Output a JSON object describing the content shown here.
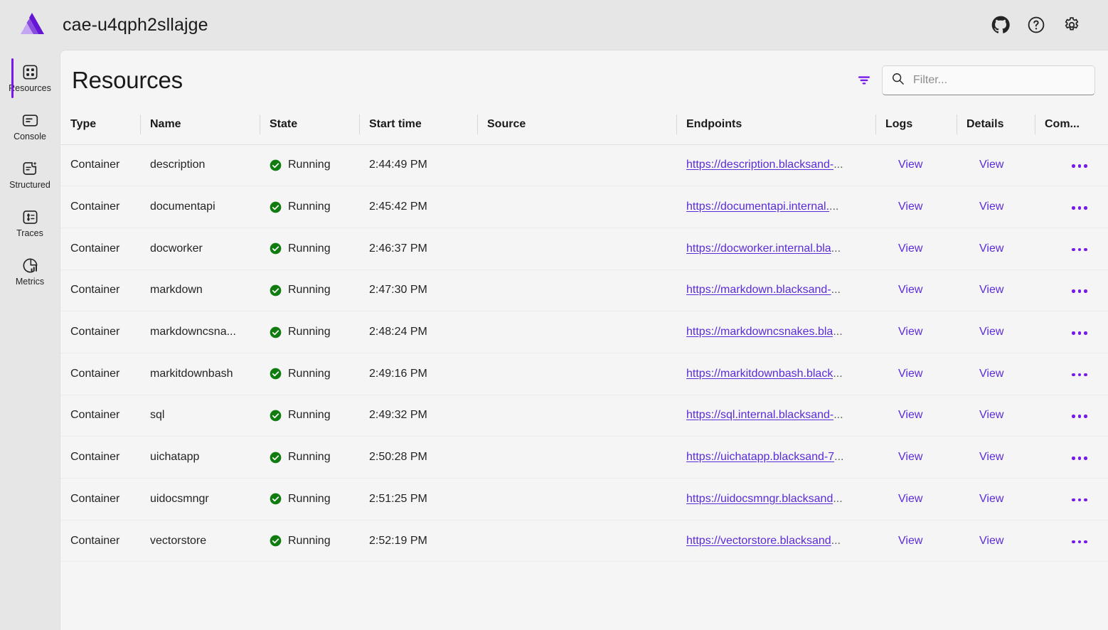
{
  "header": {
    "app_title": "cae-u4qph2sllajge",
    "logo_icon": "aspire-logo-icon",
    "actions": [
      {
        "name": "github-icon",
        "label": "GitHub"
      },
      {
        "name": "help-icon",
        "label": "Help"
      },
      {
        "name": "gear-icon",
        "label": "Settings"
      }
    ]
  },
  "sidebar": {
    "items": [
      {
        "label": "Resources",
        "icon": "grid-apps-icon",
        "active": true
      },
      {
        "label": "Console",
        "icon": "console-lines-icon",
        "active": false
      },
      {
        "label": "Structured",
        "icon": "structured-logs-icon",
        "active": false
      },
      {
        "label": "Traces",
        "icon": "traces-icon",
        "active": false
      },
      {
        "label": "Metrics",
        "icon": "metrics-pie-icon",
        "active": false
      }
    ]
  },
  "page": {
    "title": "Resources",
    "filter_toggle_icon": "filter-icon",
    "search": {
      "icon": "search-icon",
      "placeholder": "Filter...",
      "value": ""
    }
  },
  "table": {
    "columns": [
      "Type",
      "Name",
      "State",
      "Start time",
      "Source",
      "Endpoints",
      "Logs",
      "Details",
      "Com..."
    ],
    "rows": [
      {
        "type": "Container",
        "name": "description",
        "state": "Running",
        "state_icon": "success-check-icon",
        "start_time": "2:44:49 PM",
        "source": "",
        "endpoint": "https://description.blacksand-",
        "endpoint_truncated": "...",
        "logs": "View",
        "details": "View",
        "commands_icon": "more-actions-icon"
      },
      {
        "type": "Container",
        "name": "documentapi",
        "state": "Running",
        "state_icon": "success-check-icon",
        "start_time": "2:45:42 PM",
        "source": "",
        "endpoint": "https://documentapi.internal.",
        "endpoint_truncated": "...",
        "logs": "View",
        "details": "View",
        "commands_icon": "more-actions-icon"
      },
      {
        "type": "Container",
        "name": "docworker",
        "state": "Running",
        "state_icon": "success-check-icon",
        "start_time": "2:46:37 PM",
        "source": "",
        "endpoint": "https://docworker.internal.bla",
        "endpoint_truncated": "...",
        "logs": "View",
        "details": "View",
        "commands_icon": "more-actions-icon"
      },
      {
        "type": "Container",
        "name": "markdown",
        "state": "Running",
        "state_icon": "success-check-icon",
        "start_time": "2:47:30 PM",
        "source": "",
        "endpoint": "https://markdown.blacksand-",
        "endpoint_truncated": "...",
        "logs": "View",
        "details": "View",
        "commands_icon": "more-actions-icon"
      },
      {
        "type": "Container",
        "name": "markdowncsna...",
        "state": "Running",
        "state_icon": "success-check-icon",
        "start_time": "2:48:24 PM",
        "source": "",
        "endpoint": "https://markdowncsnakes.bla",
        "endpoint_truncated": "...",
        "logs": "View",
        "details": "View",
        "commands_icon": "more-actions-icon"
      },
      {
        "type": "Container",
        "name": "markitdownbash",
        "state": "Running",
        "state_icon": "success-check-icon",
        "start_time": "2:49:16 PM",
        "source": "",
        "endpoint": "https://markitdownbash.black",
        "endpoint_truncated": "...",
        "logs": "View",
        "details": "View",
        "commands_icon": "more-actions-icon"
      },
      {
        "type": "Container",
        "name": "sql",
        "state": "Running",
        "state_icon": "success-check-icon",
        "start_time": "2:49:32 PM",
        "source": "",
        "endpoint": "https://sql.internal.blacksand-",
        "endpoint_truncated": "...",
        "logs": "View",
        "details": "View",
        "commands_icon": "more-actions-icon"
      },
      {
        "type": "Container",
        "name": "uichatapp",
        "state": "Running",
        "state_icon": "success-check-icon",
        "start_time": "2:50:28 PM",
        "source": "",
        "endpoint": "https://uichatapp.blacksand-7",
        "endpoint_truncated": "...",
        "logs": "View",
        "details": "View",
        "commands_icon": "more-actions-icon"
      },
      {
        "type": "Container",
        "name": "uidocsmngr",
        "state": "Running",
        "state_icon": "success-check-icon",
        "start_time": "2:51:25 PM",
        "source": "",
        "endpoint": "https://uidocsmngr.blacksand",
        "endpoint_truncated": "...",
        "logs": "View",
        "details": "View",
        "commands_icon": "more-actions-icon"
      },
      {
        "type": "Container",
        "name": "vectorstore",
        "state": "Running",
        "state_icon": "success-check-icon",
        "start_time": "2:52:19 PM",
        "source": "",
        "endpoint": "https://vectorstore.blacksand",
        "endpoint_truncated": "...",
        "logs": "View",
        "details": "View",
        "commands_icon": "more-actions-icon"
      }
    ]
  },
  "colors": {
    "accent": "#7719ec",
    "link": "#5b2bd9",
    "success": "#107c10",
    "chrome_bg": "#e6e6e6",
    "panel_bg": "#f5f5f5"
  }
}
